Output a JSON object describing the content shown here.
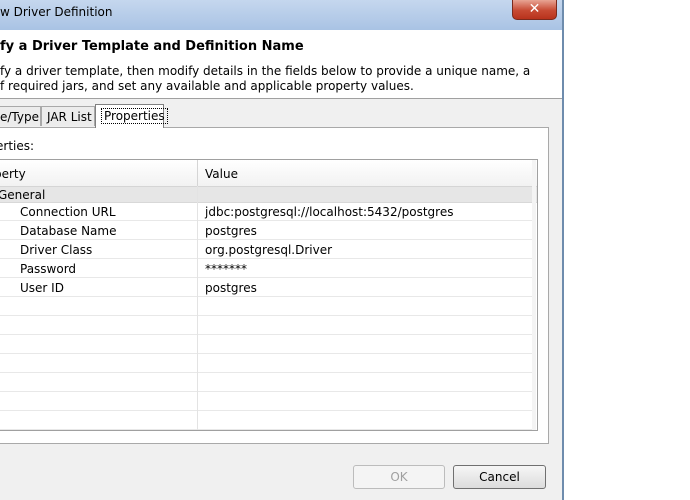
{
  "window": {
    "title": "w Driver Definition",
    "close_glyph": "✕"
  },
  "header": {
    "title": "fy a Driver Template and Definition Name",
    "description_line1": "fy a driver template, then modify details in the fields below to provide a unique name, a",
    "description_line2": "f required jars, and set any available and applicable property values."
  },
  "tabs": [
    {
      "label": "e/Type",
      "selected": false
    },
    {
      "label": "JAR List",
      "selected": false
    },
    {
      "label": "Properties",
      "selected": true
    }
  ],
  "properties_panel": {
    "label": "erties:",
    "columns": {
      "property": "perty",
      "value": "Value"
    },
    "category": "General",
    "rows": [
      {
        "name": "Connection URL",
        "value": "jdbc:postgresql://localhost:5432/postgres"
      },
      {
        "name": "Database Name",
        "value": "postgres"
      },
      {
        "name": "Driver Class",
        "value": "org.postgresql.Driver"
      },
      {
        "name": "Password",
        "value": "*******"
      },
      {
        "name": "User ID",
        "value": "postgres"
      }
    ]
  },
  "buttons": {
    "ok": "OK",
    "cancel": "Cancel"
  },
  "colors": {
    "titlebar": "#b9cfea",
    "close_button": "#c74a33",
    "dialog_background": "#f0f0f0",
    "category_row": "#e6e6e6"
  }
}
